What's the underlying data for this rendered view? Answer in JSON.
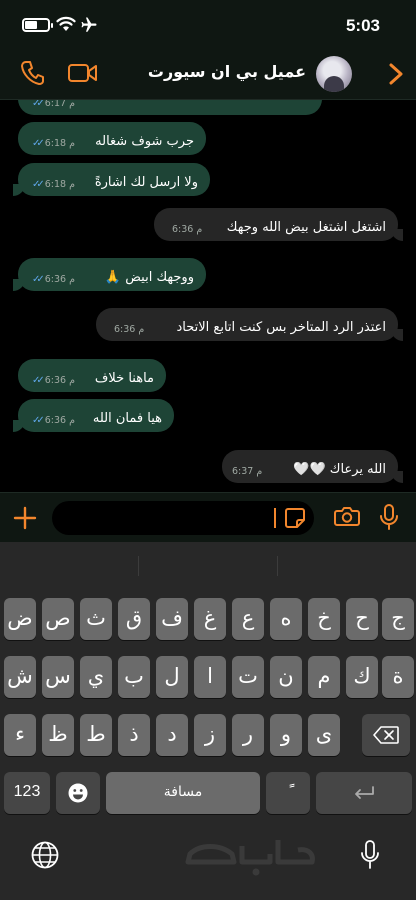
{
  "status_bar": {
    "time": "5:03",
    "battery_level": 0.55,
    "icons": [
      "battery-icon",
      "wifi-icon",
      "airplane-icon"
    ]
  },
  "header": {
    "contact_name": "عميل بي ان سيورت",
    "icons": [
      "phone-icon",
      "video-icon",
      "avatar",
      "back-chevron-icon"
    ],
    "accent_color": "#f2862d"
  },
  "messages": [
    {
      "direction": "outgoing",
      "text": "",
      "time": "6:17 م",
      "read": true
    },
    {
      "direction": "outgoing",
      "text": "جرب شوف شغاله",
      "time": "6:18 م",
      "read": true
    },
    {
      "direction": "outgoing",
      "text": "ولا ارسل لك اشارةً",
      "time": "6:18 م",
      "read": true
    },
    {
      "direction": "incoming",
      "text": "اشتغل اشتغل بيض الله وجهك",
      "time": "6:36 م"
    },
    {
      "direction": "outgoing",
      "text": "ووجهك ابيض 🙏",
      "time": "6:36 م",
      "read": true
    },
    {
      "direction": "incoming",
      "text": "اعتذر الرد المتاخر بس كنت اتابع الاتحاد",
      "time": "6:36 م"
    },
    {
      "direction": "outgoing",
      "text": "ماهنا خلاف",
      "time": "6:36 م",
      "read": true
    },
    {
      "direction": "outgoing",
      "text": "هيا فمان الله",
      "time": "6:36 م",
      "read": true
    },
    {
      "direction": "incoming",
      "text": "الله يرعاك 🤍🤍",
      "time": "6:37 م"
    }
  ],
  "input_bar": {
    "placeholder": "",
    "icons": [
      "plus-icon",
      "sticker-icon",
      "camera-icon",
      "mic-icon"
    ]
  },
  "keyboard": {
    "row1": [
      "ض",
      "ص",
      "ث",
      "ق",
      "ف",
      "غ",
      "ع",
      "ه",
      "خ",
      "ح",
      "ج"
    ],
    "row2": [
      "ش",
      "س",
      "ي",
      "ب",
      "ل",
      "ا",
      "ت",
      "ن",
      "م",
      "ك",
      "ة"
    ],
    "row3": [
      "ء",
      "ظ",
      "ط",
      "ذ",
      "د",
      "ز",
      "ر",
      "و",
      "ى"
    ],
    "numbers_key": "123",
    "space_key": "مسافة",
    "diacritic_key": "ًً",
    "icons": [
      "delete-icon",
      "emoji-icon",
      "return-icon",
      "globe-icon",
      "dictation-mic-icon"
    ]
  },
  "watermark": {
    "text": "حراج"
  },
  "colors": {
    "outgoing_bubble": "#1e4436",
    "incoming_bubble": "#262626",
    "accent": "#f2862d",
    "read_ticks": "#5fa6e8"
  }
}
